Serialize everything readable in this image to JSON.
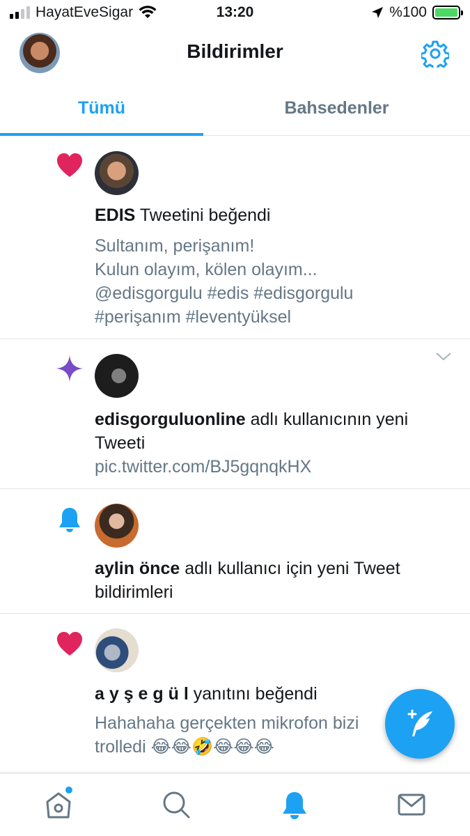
{
  "status_bar": {
    "carrier": "HayatEveSigar",
    "time": "13:20",
    "battery": "%100"
  },
  "header": {
    "title": "Bildirimler"
  },
  "tabs": [
    {
      "label": "Tümü",
      "active": true
    },
    {
      "label": "Bahsedenler",
      "active": false
    }
  ],
  "notifications": [
    {
      "type": "like",
      "icon": "heart-icon",
      "user": "EDIS",
      "action": " Tweetini beğendi",
      "content_lines": [
        "Sultanım, perişanım!",
        "Kulun olayım, kölen olayım...",
        "@edisgorgulu #edis #edisgorgulu",
        "#perişanım #leventyüksel"
      ]
    },
    {
      "type": "recommendation",
      "icon": "sparkle-icon",
      "user": "edisgorguluonline",
      "action": " adlı kullanıcının yeni",
      "action_line2": "Tweeti",
      "content_lines": [
        "pic.twitter.com/BJ5gqnqkHX"
      ]
    },
    {
      "type": "notification",
      "icon": "bell-icon",
      "user": "aylin önce",
      "action": " adlı kullanıcı için yeni Tweet",
      "action_line2": "bildirimleri"
    },
    {
      "type": "like",
      "icon": "heart-icon",
      "user": "a y ş e g ü l",
      "action": " yanıtını beğendi",
      "content_lines": [
        "Hahahaha gerçekten mikrofon bizi",
        "trolledi 😂😂🤣😂😂😂"
      ]
    }
  ],
  "colors": {
    "accent": "#1da1f2",
    "like": "#e0245e",
    "sparkle": "#794bc4",
    "muted": "#657786"
  }
}
